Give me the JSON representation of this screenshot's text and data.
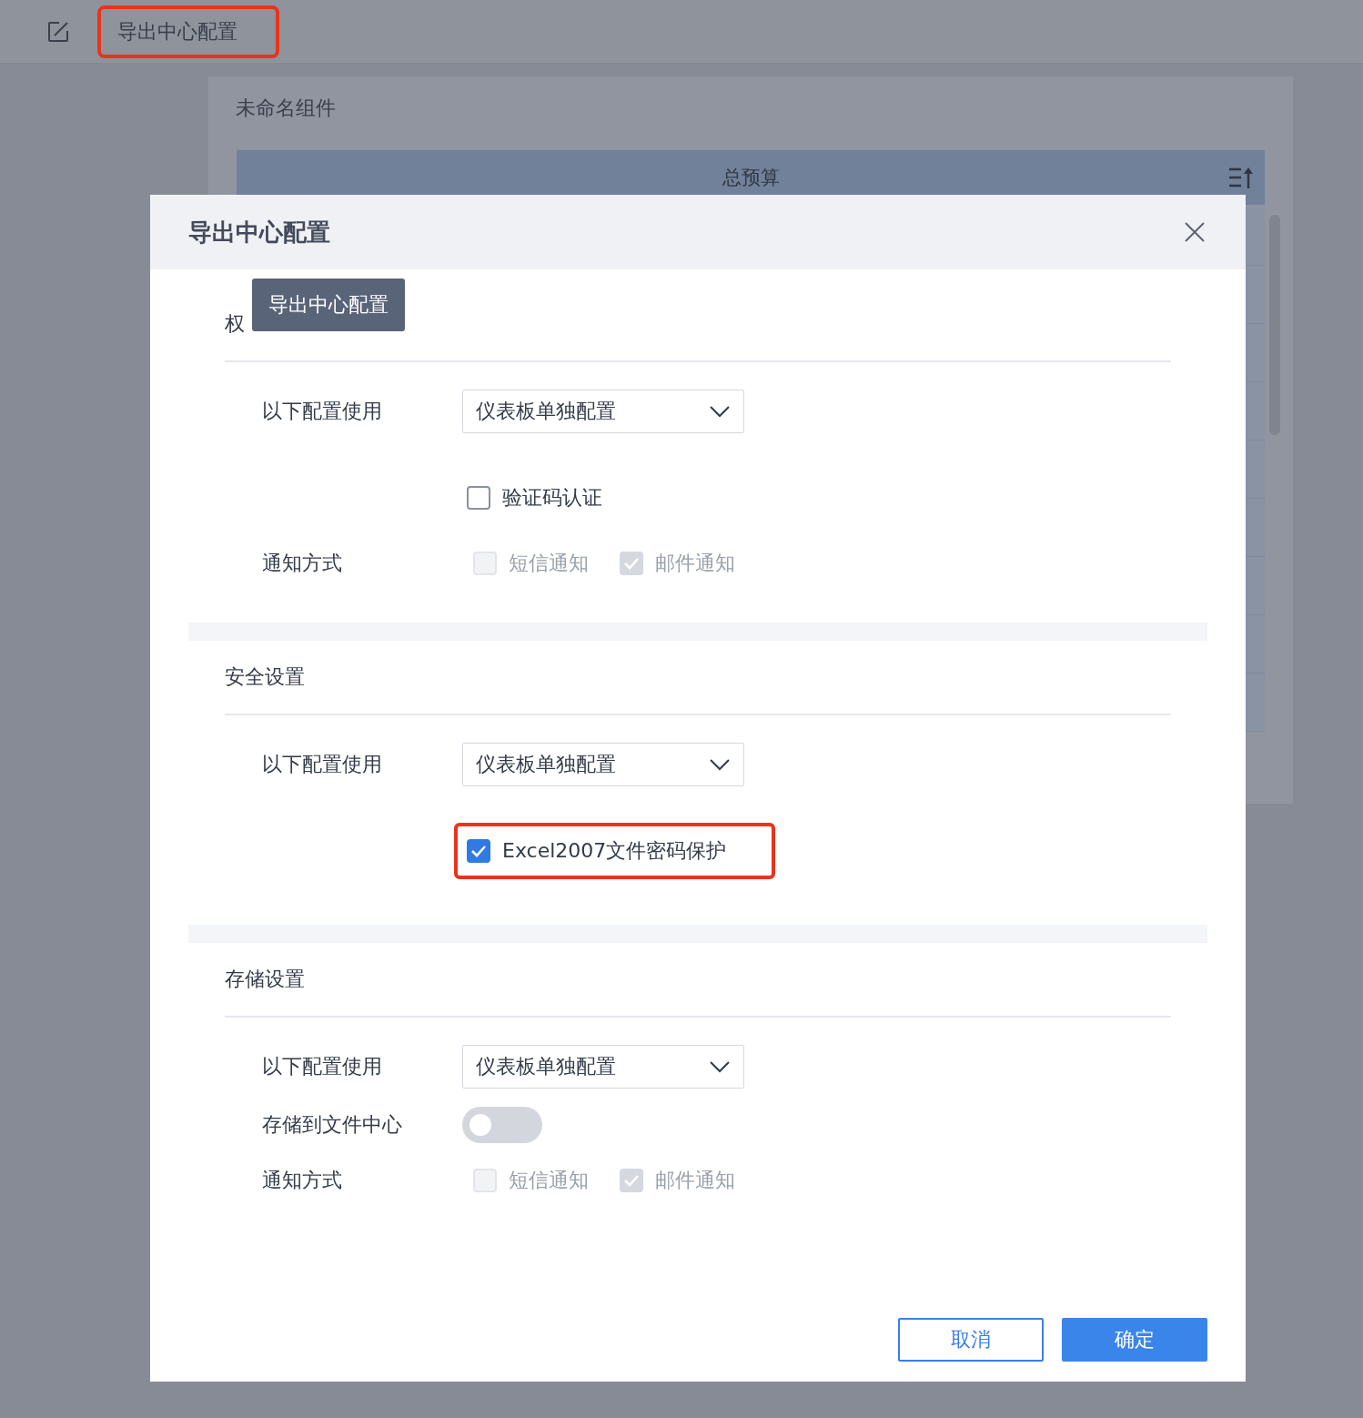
{
  "toolbar": {
    "title": "导出中心配置",
    "highlighted": true
  },
  "background_card": {
    "title": "未命名组件",
    "table": {
      "columns": [
        "总预算"
      ]
    }
  },
  "dialog": {
    "title": "导出中心配置",
    "tooltip": "导出中心配置",
    "sections": [
      {
        "title": "权",
        "rows": [
          {
            "kind": "select",
            "label": "以下配置使用",
            "value": "仪表板单独配置"
          },
          {
            "kind": "checkbox",
            "text": "验证码认证",
            "checked": false,
            "disabled": false,
            "highlighted": false
          },
          {
            "kind": "checkgroup",
            "label": "通知方式",
            "options": [
              {
                "text": "短信通知",
                "checked": false,
                "disabled": true
              },
              {
                "text": "邮件通知",
                "checked": true,
                "disabled": true
              }
            ]
          }
        ]
      },
      {
        "title": "安全设置",
        "rows": [
          {
            "kind": "select",
            "label": "以下配置使用",
            "value": "仪表板单独配置"
          },
          {
            "kind": "checkbox",
            "text": "Excel2007文件密码保护",
            "checked": true,
            "disabled": false,
            "highlighted": true
          }
        ]
      },
      {
        "title": "存储设置",
        "rows": [
          {
            "kind": "select",
            "label": "以下配置使用",
            "value": "仪表板单独配置"
          },
          {
            "kind": "toggle",
            "label": "存储到文件中心",
            "on": false
          },
          {
            "kind": "checkgroup",
            "label": "通知方式",
            "options": [
              {
                "text": "短信通知",
                "checked": false,
                "disabled": true
              },
              {
                "text": "邮件通知",
                "checked": true,
                "disabled": true
              }
            ]
          }
        ]
      }
    ],
    "buttons": [
      {
        "label": "取消",
        "kind": "secondary"
      },
      {
        "label": "确定",
        "kind": "primary"
      }
    ]
  }
}
